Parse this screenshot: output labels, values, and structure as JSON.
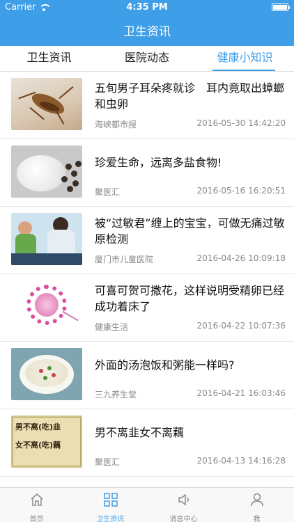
{
  "status_bar": {
    "carrier": "Carrier",
    "time": "4:35 PM"
  },
  "header": {
    "title": "卫生资讯"
  },
  "tabs": [
    {
      "label": "卫生资讯",
      "active": false
    },
    {
      "label": "医院动态",
      "active": false
    },
    {
      "label": "健康小知识",
      "active": true
    }
  ],
  "news": [
    {
      "title": "五旬男子耳朵疼就诊　耳内竟取出蟑螂和虫卵",
      "source": "海峡都市报",
      "date": "2016-05-30 14:42:20",
      "thumb": "cockroach-image"
    },
    {
      "title": "珍爱生命，远离多盐食物!",
      "source": "聚医汇",
      "date": "2016-05-16 16:20:51",
      "thumb": "salt-image"
    },
    {
      "title": "被“过敏君”缠上的宝宝，可做无痛过敏原检测",
      "source": "厦门市儿童医院",
      "date": "2016-04-26 10:09:18",
      "thumb": "clinic-image"
    },
    {
      "title": "可喜可贺可撒花，这样说明受精卵已经成功着床了",
      "source": "健康生活",
      "date": "2016-04-22 10:07:36",
      "thumb": "cell-image"
    },
    {
      "title": "外面的汤泡饭和粥能一样吗?",
      "source": "三九养生堂",
      "date": "2016-04-21 16:03:46",
      "thumb": "porridge-image"
    },
    {
      "title": "男不离韭女不离藕",
      "source": "聚医汇",
      "date": "2016-04-13 14:16:28",
      "thumb": "poster-image",
      "thumb_text": [
        "男不离(吃)韭",
        "女不离(吃)藕"
      ]
    }
  ],
  "tabbar": [
    {
      "label": "首页",
      "icon": "home-icon",
      "active": false
    },
    {
      "label": "卫生资讯",
      "icon": "grid-icon",
      "active": true
    },
    {
      "label": "消息中心",
      "icon": "speaker-icon",
      "active": false
    },
    {
      "label": "我",
      "icon": "person-icon",
      "active": false
    }
  ],
  "colors": {
    "accent": "#3e9ee8"
  }
}
